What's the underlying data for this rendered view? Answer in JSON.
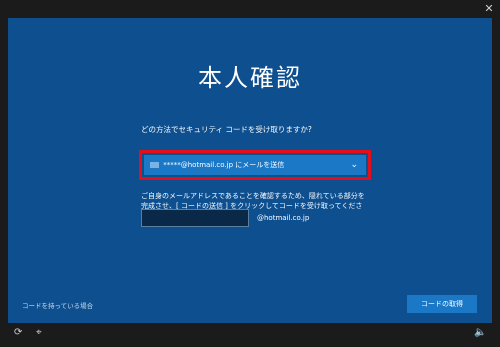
{
  "window": {
    "close_glyph": "✕"
  },
  "main": {
    "title": "本人確認",
    "method_label": "どの方法でセキュリティ コードを受け取りますか?",
    "method_select_value": "*****@hotmail.co.jp にメールを送信",
    "note": "ご自身のメールアドレスであることを確認するため、隠れている部分を完成させ、[ コードの送信 ] をクリックしてコードを受け取ってください。",
    "email_input_value": "",
    "email_suffix": "@hotmail.co.jp",
    "have_code_link": "コードを持っている場合",
    "get_code_button": "コードの取得"
  },
  "colors": {
    "panel": "#0e4f8f",
    "accent": "#1b78c7",
    "highlight": "#e2101b"
  },
  "icons": {
    "close": "close-icon",
    "mail": "mail-icon",
    "chevron": "chevron-down-icon",
    "ease_of_access": "ease-of-access-icon",
    "mic": "microphone-icon",
    "volume": "volume-icon"
  }
}
